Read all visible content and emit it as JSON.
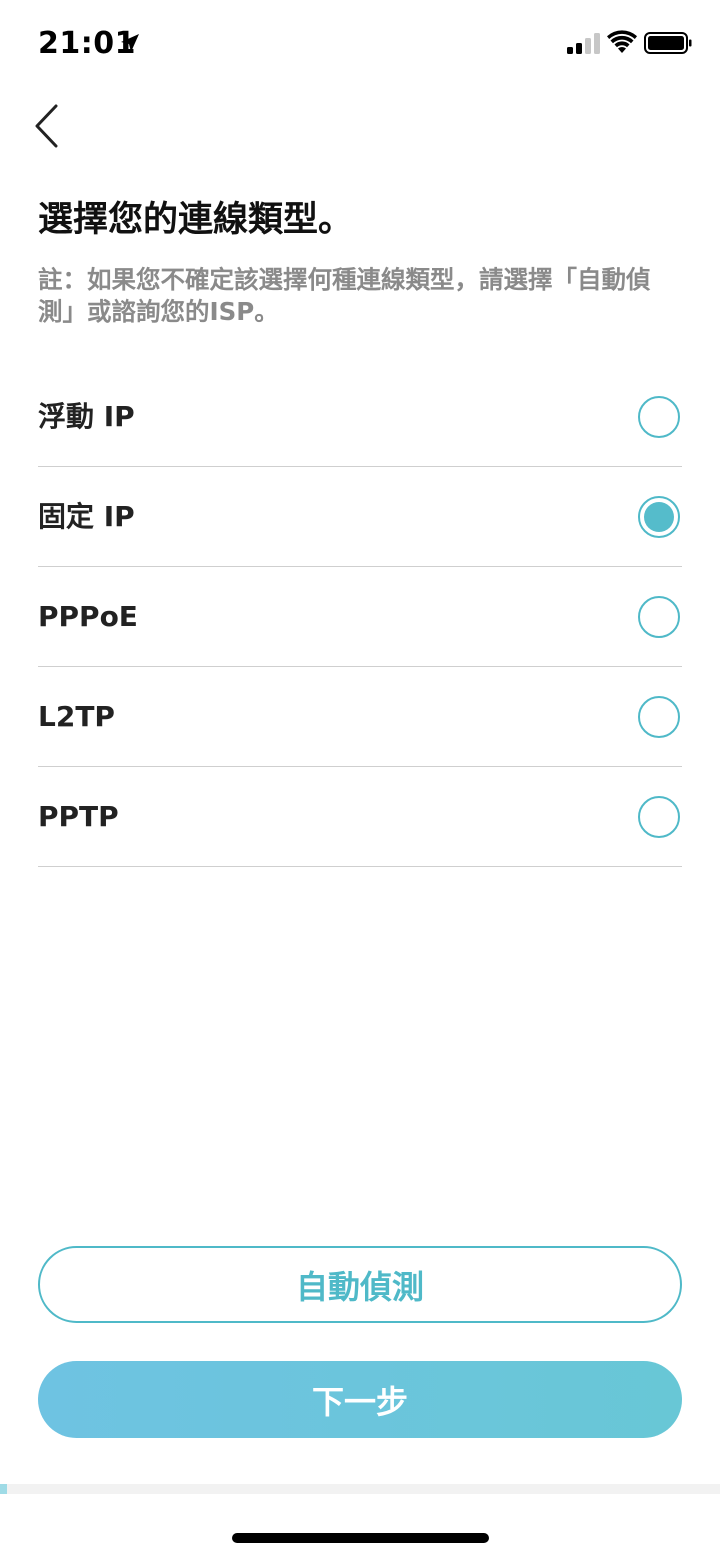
{
  "status_bar": {
    "time": "21:01",
    "icons": [
      "location-arrow-icon",
      "cellular-signal-icon",
      "wifi-icon",
      "battery-icon"
    ]
  },
  "nav": {
    "back_icon": "chevron-left-icon"
  },
  "header": {
    "title": "選擇您的連線類型。",
    "note": "註：如果您不確定該選擇何種連線類型，請選擇「自動偵測」或諮詢您的ISP。"
  },
  "options": [
    {
      "label": "浮動 IP",
      "selected": false
    },
    {
      "label": "固定 IP",
      "selected": true
    },
    {
      "label": "PPPoE",
      "selected": false
    },
    {
      "label": "L2TP",
      "selected": false
    },
    {
      "label": "PPTP",
      "selected": false
    }
  ],
  "buttons": {
    "auto_detect": "自動偵測",
    "next": "下一步"
  },
  "progress": {
    "fraction": 0.01
  },
  "colors": {
    "accent": "#4fb9c8",
    "radio_fill": "#55bccb",
    "next_gradient_start": "#6ec3e2",
    "next_gradient_end": "#68c7d6",
    "note_text": "#8a8a8a",
    "divider": "#cfcfcf"
  }
}
